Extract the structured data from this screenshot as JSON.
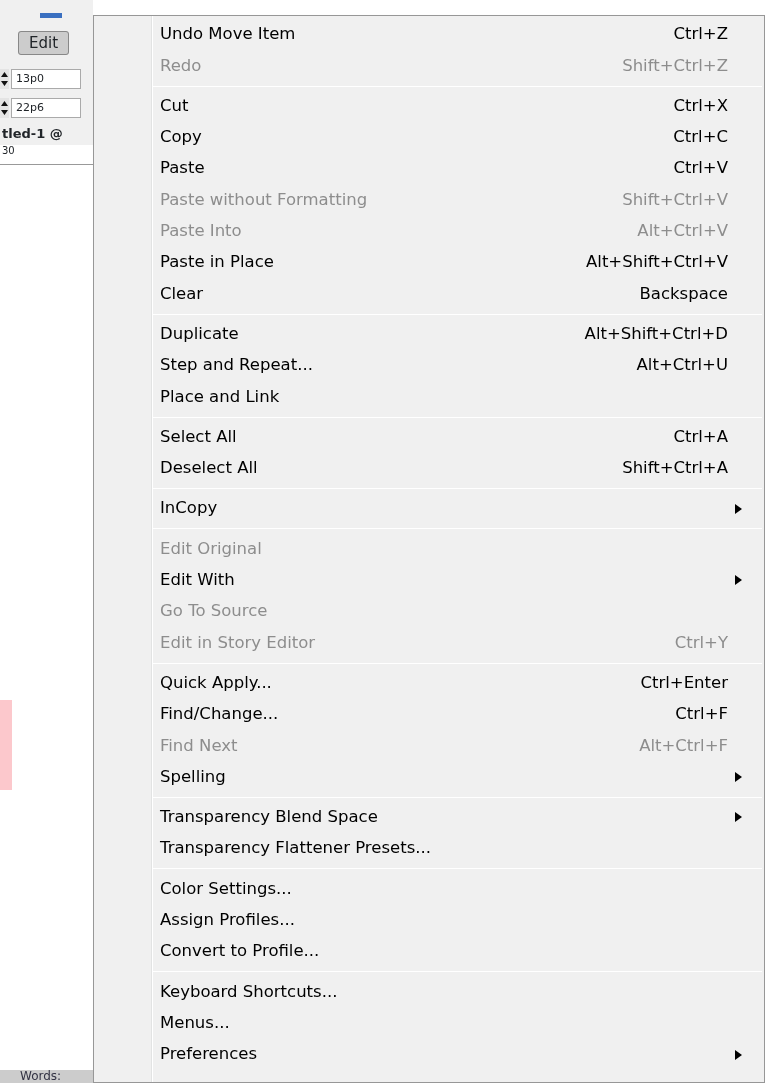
{
  "background_app": {
    "edit_button": "Edit",
    "fields": [
      {
        "value": "13p0"
      },
      {
        "value": "22p6"
      }
    ],
    "document_tab": "tled-1 @",
    "ruler_label": "30",
    "status_label": "Words:"
  },
  "menu": {
    "groups": [
      [
        {
          "label": "Undo Move Item",
          "shortcut": "Ctrl+Z",
          "disabled": false,
          "submenu": false
        },
        {
          "label": "Redo",
          "shortcut": "Shift+Ctrl+Z",
          "disabled": true,
          "submenu": false
        }
      ],
      [
        {
          "label": "Cut",
          "shortcut": "Ctrl+X",
          "disabled": false,
          "submenu": false
        },
        {
          "label": "Copy",
          "shortcut": "Ctrl+C",
          "disabled": false,
          "submenu": false
        },
        {
          "label": "Paste",
          "shortcut": "Ctrl+V",
          "disabled": false,
          "submenu": false
        },
        {
          "label": "Paste without Formatting",
          "shortcut": "Shift+Ctrl+V",
          "disabled": true,
          "submenu": false
        },
        {
          "label": "Paste Into",
          "shortcut": "Alt+Ctrl+V",
          "disabled": true,
          "submenu": false
        },
        {
          "label": "Paste in Place",
          "shortcut": "Alt+Shift+Ctrl+V",
          "disabled": false,
          "submenu": false
        },
        {
          "label": "Clear",
          "shortcut": "Backspace",
          "disabled": false,
          "submenu": false
        }
      ],
      [
        {
          "label": "Duplicate",
          "shortcut": "Alt+Shift+Ctrl+D",
          "disabled": false,
          "submenu": false
        },
        {
          "label": "Step and Repeat...",
          "shortcut": "Alt+Ctrl+U",
          "disabled": false,
          "submenu": false
        },
        {
          "label": "Place and Link",
          "disabled": false,
          "submenu": false
        }
      ],
      [
        {
          "label": "Select All",
          "shortcut": "Ctrl+A",
          "disabled": false,
          "submenu": false
        },
        {
          "label": "Deselect All",
          "shortcut": "Shift+Ctrl+A",
          "disabled": false,
          "submenu": false
        }
      ],
      [
        {
          "label": "InCopy",
          "disabled": false,
          "submenu": true
        }
      ],
      [
        {
          "label": "Edit Original",
          "disabled": true,
          "submenu": false
        },
        {
          "label": "Edit With",
          "disabled": false,
          "submenu": true
        },
        {
          "label": "Go To Source",
          "disabled": true,
          "submenu": false
        },
        {
          "label": "Edit in Story Editor",
          "shortcut": "Ctrl+Y",
          "disabled": true,
          "submenu": false
        }
      ],
      [
        {
          "label": "Quick Apply...",
          "shortcut": "Ctrl+Enter",
          "disabled": false,
          "submenu": false
        },
        {
          "label": "Find/Change...",
          "shortcut": "Ctrl+F",
          "disabled": false,
          "submenu": false
        },
        {
          "label": "Find Next",
          "shortcut": "Alt+Ctrl+F",
          "disabled": true,
          "submenu": false
        },
        {
          "label": "Spelling",
          "disabled": false,
          "submenu": true
        }
      ],
      [
        {
          "label": "Transparency Blend Space",
          "disabled": false,
          "submenu": true
        },
        {
          "label": "Transparency Flattener Presets...",
          "disabled": false,
          "submenu": false
        }
      ],
      [
        {
          "label": "Color Settings...",
          "disabled": false,
          "submenu": false
        },
        {
          "label": "Assign Profiles...",
          "disabled": false,
          "submenu": false
        },
        {
          "label": "Convert to Profile...",
          "disabled": false,
          "submenu": false
        }
      ],
      [
        {
          "label": "Keyboard Shortcuts...",
          "disabled": false,
          "submenu": false
        },
        {
          "label": "Menus...",
          "disabled": false,
          "submenu": false
        },
        {
          "label": "Preferences",
          "disabled": false,
          "submenu": true
        }
      ]
    ]
  }
}
